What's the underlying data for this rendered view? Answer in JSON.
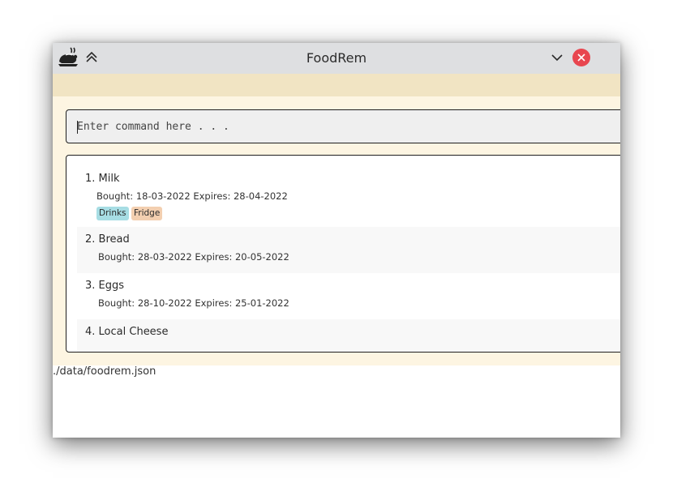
{
  "window": {
    "title": "FoodRem",
    "app_icon": "roast-chicken-icon",
    "close_color": "#e8464f"
  },
  "command": {
    "placeholder": "Enter command here . . .",
    "value": ""
  },
  "items": [
    {
      "index": "1.",
      "name": "Milk",
      "dates": "Bought: 18-03-2022  Expires: 28-04-2022",
      "tags": [
        {
          "label": "Drinks",
          "color": "#a7dde4"
        },
        {
          "label": "Fridge",
          "color": "#f3cfb0"
        }
      ]
    },
    {
      "index": "2.",
      "name": "Bread",
      "dates": "Bought: 28-03-2022  Expires: 20-05-2022",
      "tags": []
    },
    {
      "index": "3.",
      "name": "Eggs",
      "dates": "Bought: 28-10-2022  Expires: 25-01-2022",
      "tags": []
    },
    {
      "index": "4.",
      "name": "Local Cheese",
      "dates": "",
      "tags": []
    }
  ],
  "status": {
    "file_path": "./data/foodrem.json"
  },
  "colors": {
    "titlebar": "#dedfe1",
    "menubar": "#f1e4c3",
    "content_bg": "#fdf5e2"
  }
}
